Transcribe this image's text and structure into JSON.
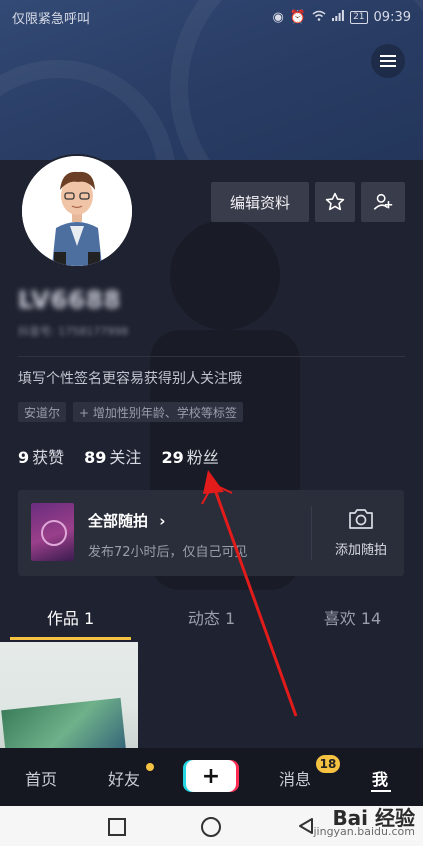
{
  "status_bar": {
    "carrier_text": "仅限紧急呼叫",
    "battery": "21",
    "time": "09:39"
  },
  "profile": {
    "username": "LV6688",
    "douyin_id": "抖音号: 1758177998",
    "bio": "填写个性签名更容易获得别人关注哦",
    "tags": [
      "安道尔",
      "+ 增加性别年龄、学校等标签"
    ],
    "edit_button": "编辑资料"
  },
  "stats": [
    {
      "value": "9",
      "label": "获赞"
    },
    {
      "value": "89",
      "label": "关注"
    },
    {
      "value": "29",
      "label": "粉丝"
    }
  ],
  "moments": {
    "title": "全部随拍",
    "chevron": "›",
    "subtitle": "发布72小时后，仅自己可见",
    "add_label": "添加随拍"
  },
  "tabs": [
    {
      "label": "作品 1",
      "active": true
    },
    {
      "label": "动态 1",
      "active": false
    },
    {
      "label": "喜欢 14",
      "active": false
    }
  ],
  "bottom_nav": {
    "home": "首页",
    "friends": "好友",
    "plus": "+",
    "messages": "消息",
    "messages_badge": "18",
    "me": "我"
  },
  "watermark": {
    "logo": "Bai 经验",
    "url": "jingyan.baidu.com"
  },
  "colors": {
    "background": "#1f2230",
    "accent_yellow": "#f5c242",
    "annotation_arrow": "#e21b1b"
  }
}
